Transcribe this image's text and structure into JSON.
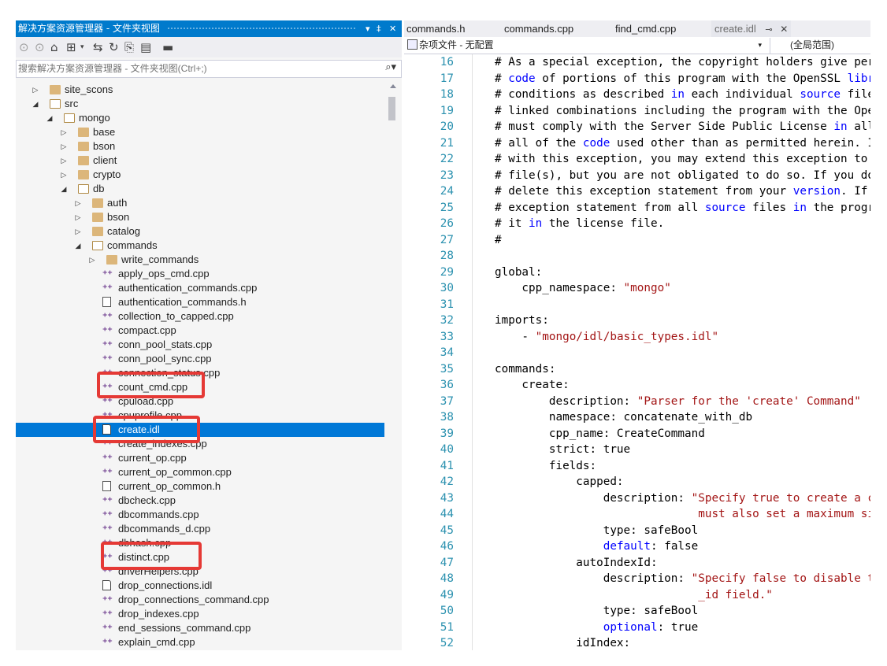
{
  "explorer": {
    "title": "解决方案资源管理器 - 文件夹视图",
    "pin_label": "▾ ‡ ✕",
    "search": {
      "placeholder": "搜索解决方案资源管理器 - 文件夹视图(Ctrl+;)",
      "icon": "search-icon"
    },
    "toolbar_icons": [
      "back-icon",
      "forward-icon",
      "home-icon",
      "switch-views-icon",
      "dropdown-icon",
      "sync-icon",
      "refresh-icon",
      "copy-icon",
      "properties-icon",
      "collapse-icon"
    ],
    "tree": [
      {
        "label": "site_scons",
        "type": "folder",
        "depth": 1,
        "expanded": false
      },
      {
        "label": "src",
        "type": "folder",
        "depth": 1,
        "expanded": true
      },
      {
        "label": "mongo",
        "type": "folder",
        "depth": 2,
        "expanded": true
      },
      {
        "label": "base",
        "type": "folder",
        "depth": 3,
        "expanded": false
      },
      {
        "label": "bson",
        "type": "folder",
        "depth": 3,
        "expanded": false
      },
      {
        "label": "client",
        "type": "folder",
        "depth": 3,
        "expanded": false
      },
      {
        "label": "crypto",
        "type": "folder",
        "depth": 3,
        "expanded": false
      },
      {
        "label": "db",
        "type": "folder",
        "depth": 3,
        "expanded": true
      },
      {
        "label": "auth",
        "type": "folder",
        "depth": 4,
        "expanded": false
      },
      {
        "label": "bson",
        "type": "folder",
        "depth": 4,
        "expanded": false
      },
      {
        "label": "catalog",
        "type": "folder",
        "depth": 4,
        "expanded": false
      },
      {
        "label": "commands",
        "type": "folder",
        "depth": 4,
        "expanded": true
      },
      {
        "label": "write_commands",
        "type": "folder",
        "depth": 5,
        "expanded": false
      },
      {
        "label": "apply_ops_cmd.cpp",
        "type": "cpp",
        "depth": 5
      },
      {
        "label": "authentication_commands.cpp",
        "type": "cpp",
        "depth": 5
      },
      {
        "label": "authentication_commands.h",
        "type": "h",
        "depth": 5
      },
      {
        "label": "collection_to_capped.cpp",
        "type": "cpp",
        "depth": 5
      },
      {
        "label": "compact.cpp",
        "type": "cpp",
        "depth": 5
      },
      {
        "label": "conn_pool_stats.cpp",
        "type": "cpp",
        "depth": 5
      },
      {
        "label": "conn_pool_sync.cpp",
        "type": "cpp",
        "depth": 5
      },
      {
        "label": "connection_status.cpp",
        "type": "cpp",
        "depth": 5
      },
      {
        "label": "count_cmd.cpp",
        "type": "cpp",
        "depth": 5
      },
      {
        "label": "cpuload.cpp",
        "type": "cpp",
        "depth": 5
      },
      {
        "label": "cpuprofile.cpp",
        "type": "cpp",
        "depth": 5
      },
      {
        "label": "create.idl",
        "type": "idl",
        "depth": 5,
        "selected": true
      },
      {
        "label": "create_indexes.cpp",
        "type": "cpp",
        "depth": 5
      },
      {
        "label": "current_op.cpp",
        "type": "cpp",
        "depth": 5
      },
      {
        "label": "current_op_common.cpp",
        "type": "cpp",
        "depth": 5
      },
      {
        "label": "current_op_common.h",
        "type": "h",
        "depth": 5
      },
      {
        "label": "dbcheck.cpp",
        "type": "cpp",
        "depth": 5
      },
      {
        "label": "dbcommands.cpp",
        "type": "cpp",
        "depth": 5
      },
      {
        "label": "dbcommands_d.cpp",
        "type": "cpp",
        "depth": 5
      },
      {
        "label": "dbhash.cpp",
        "type": "cpp",
        "depth": 5
      },
      {
        "label": "distinct.cpp",
        "type": "cpp",
        "depth": 5
      },
      {
        "label": "driverHelpers.cpp",
        "type": "cpp",
        "depth": 5
      },
      {
        "label": "drop_connections.idl",
        "type": "idl",
        "depth": 5
      },
      {
        "label": "drop_connections_command.cpp",
        "type": "cpp",
        "depth": 5
      },
      {
        "label": "drop_indexes.cpp",
        "type": "cpp",
        "depth": 5
      },
      {
        "label": "end_sessions_command.cpp",
        "type": "cpp",
        "depth": 5
      },
      {
        "label": "explain_cmd.cpp",
        "type": "cpp",
        "depth": 5
      }
    ],
    "highlight_color": "#e53935",
    "selection_color": "#0078d7"
  },
  "editor": {
    "tabs": [
      {
        "label": "commands.h",
        "active": false
      },
      {
        "label": "commands.cpp",
        "active": false
      },
      {
        "label": "find_cmd.cpp",
        "active": false
      },
      {
        "label": "create.idl",
        "active": true,
        "pin": "⊸",
        "close": "✕"
      }
    ],
    "nav": {
      "project": "杂项文件 - 无配置",
      "scope": "(全局范围)"
    },
    "code_lines": [
      {
        "n": "16",
        "parts": [
          [
            "t",
            "# As a special exception, the copyright holders give permi"
          ]
        ]
      },
      {
        "n": "17",
        "parts": [
          [
            "t",
            "# "
          ],
          [
            "k",
            "code"
          ],
          [
            "t",
            " of portions of this program with the OpenSSL "
          ],
          [
            "k",
            "librar"
          ]
        ]
      },
      {
        "n": "18",
        "parts": [
          [
            "t",
            "# conditions as described "
          ],
          [
            "k",
            "in"
          ],
          [
            "t",
            " each individual "
          ],
          [
            "k",
            "source"
          ],
          [
            "t",
            " file a"
          ]
        ]
      },
      {
        "n": "19",
        "parts": [
          [
            "t",
            "# linked combinations including the program with the OpenS"
          ]
        ]
      },
      {
        "n": "20",
        "parts": [
          [
            "t",
            "# must comply with the Server Side Public License "
          ],
          [
            "k",
            "in"
          ],
          [
            "t",
            " all r"
          ]
        ]
      },
      {
        "n": "21",
        "parts": [
          [
            "t",
            "# all of the "
          ],
          [
            "k",
            "code"
          ],
          [
            "t",
            " used other than as permitted herein. If"
          ]
        ]
      },
      {
        "n": "22",
        "parts": [
          [
            "t",
            "# with this exception, you may extend this exception to yo"
          ]
        ]
      },
      {
        "n": "23",
        "parts": [
          [
            "t",
            "# file(s), but you are not obligated to do so. If you do n"
          ]
        ]
      },
      {
        "n": "24",
        "parts": [
          [
            "t",
            "# delete this exception statement from your "
          ],
          [
            "k",
            "version"
          ],
          [
            "t",
            ". If yo"
          ]
        ]
      },
      {
        "n": "25",
        "parts": [
          [
            "t",
            "# exception statement from all "
          ],
          [
            "k",
            "source"
          ],
          [
            "t",
            " files "
          ],
          [
            "k",
            "in"
          ],
          [
            "t",
            " the program"
          ]
        ]
      },
      {
        "n": "26",
        "parts": [
          [
            "t",
            "# it "
          ],
          [
            "k",
            "in"
          ],
          [
            "t",
            " the license file."
          ]
        ]
      },
      {
        "n": "27",
        "parts": [
          [
            "t",
            "#"
          ]
        ]
      },
      {
        "n": "28",
        "parts": [
          [
            "t",
            ""
          ]
        ]
      },
      {
        "n": "29",
        "parts": [
          [
            "t",
            "global:"
          ]
        ]
      },
      {
        "n": "30",
        "parts": [
          [
            "t",
            "    cpp_namespace: "
          ],
          [
            "s",
            "\"mongo\""
          ]
        ]
      },
      {
        "n": "31",
        "parts": [
          [
            "t",
            ""
          ]
        ]
      },
      {
        "n": "32",
        "parts": [
          [
            "t",
            "imports:"
          ]
        ]
      },
      {
        "n": "33",
        "parts": [
          [
            "t",
            "    - "
          ],
          [
            "s",
            "\"mongo/idl/basic_types.idl\""
          ]
        ]
      },
      {
        "n": "34",
        "parts": [
          [
            "t",
            ""
          ]
        ]
      },
      {
        "n": "35",
        "parts": [
          [
            "t",
            "commands:"
          ]
        ]
      },
      {
        "n": "36",
        "parts": [
          [
            "t",
            "    create:"
          ]
        ]
      },
      {
        "n": "37",
        "parts": [
          [
            "t",
            "        description: "
          ],
          [
            "s",
            "\"Parser for the 'create' Command\""
          ]
        ]
      },
      {
        "n": "38",
        "parts": [
          [
            "t",
            "        namespace: concatenate_with_db"
          ]
        ]
      },
      {
        "n": "39",
        "parts": [
          [
            "t",
            "        cpp_name: CreateCommand"
          ]
        ]
      },
      {
        "n": "40",
        "parts": [
          [
            "t",
            "        strict: true"
          ]
        ]
      },
      {
        "n": "41",
        "parts": [
          [
            "t",
            "        fields:"
          ]
        ]
      },
      {
        "n": "42",
        "parts": [
          [
            "t",
            "            capped:"
          ]
        ]
      },
      {
        "n": "43",
        "parts": [
          [
            "t",
            "                description: "
          ],
          [
            "s",
            "\"Specify true to create a cap"
          ]
        ]
      },
      {
        "n": "44",
        "parts": [
          [
            "s",
            "                              must also set a maximum size"
          ]
        ]
      },
      {
        "n": "45",
        "parts": [
          [
            "t",
            "                type: safeBool"
          ]
        ]
      },
      {
        "n": "46",
        "parts": [
          [
            "t",
            "                "
          ],
          [
            "k",
            "default"
          ],
          [
            "t",
            ": false"
          ]
        ]
      },
      {
        "n": "47",
        "parts": [
          [
            "t",
            "            autoIndexId:"
          ]
        ]
      },
      {
        "n": "48",
        "parts": [
          [
            "t",
            "                description: "
          ],
          [
            "s",
            "\"Specify false to disable the"
          ]
        ]
      },
      {
        "n": "49",
        "parts": [
          [
            "s",
            "                              _id field.\""
          ]
        ]
      },
      {
        "n": "50",
        "parts": [
          [
            "t",
            "                type: safeBool"
          ]
        ]
      },
      {
        "n": "51",
        "parts": [
          [
            "t",
            "                "
          ],
          [
            "k",
            "optional"
          ],
          [
            "t",
            ": true"
          ]
        ]
      },
      {
        "n": "52",
        "parts": [
          [
            "t",
            "            idIndex:"
          ]
        ]
      }
    ]
  }
}
